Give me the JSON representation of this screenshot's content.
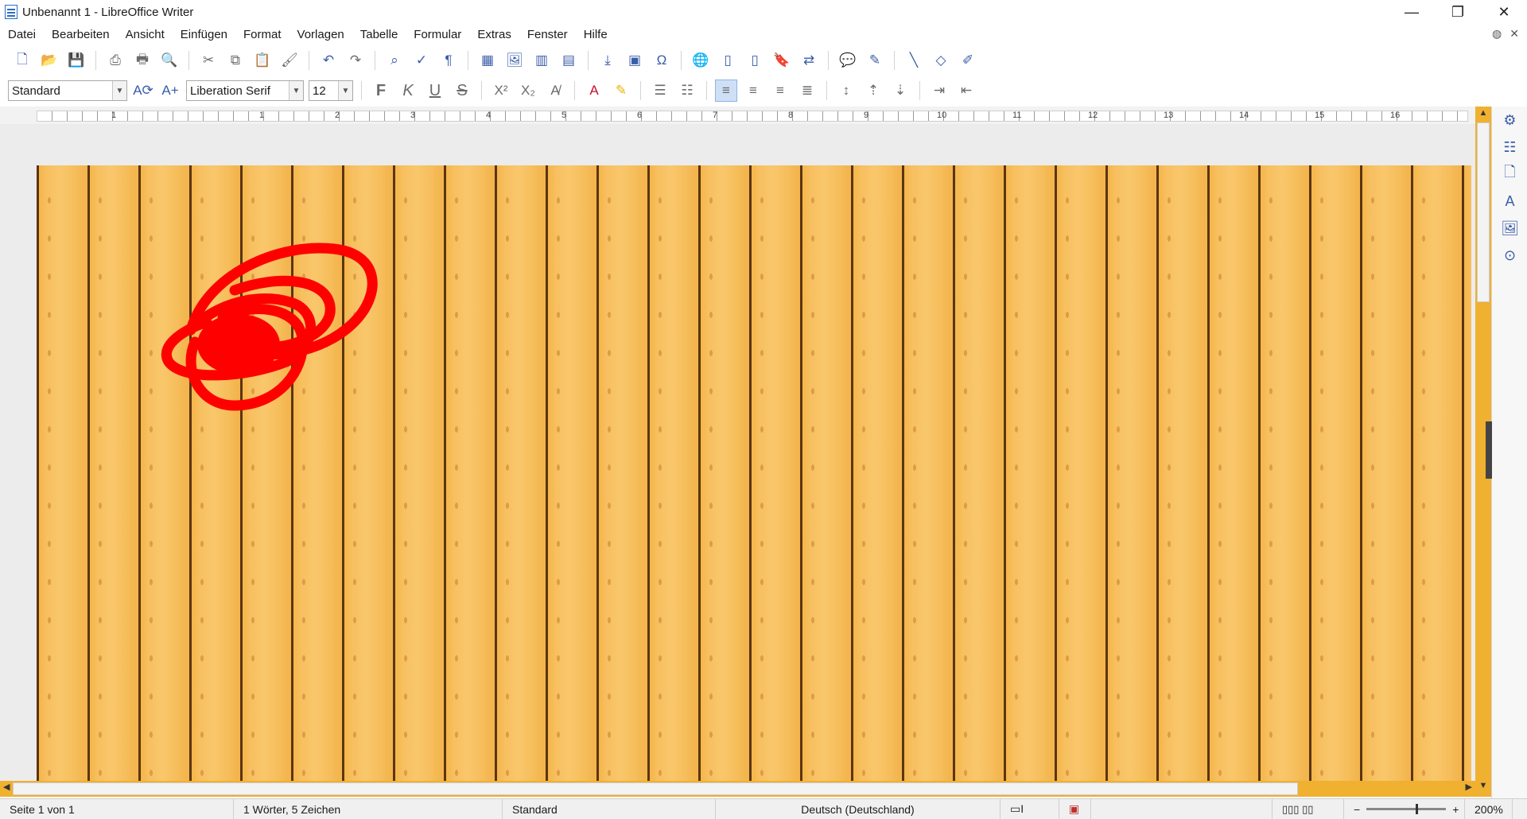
{
  "window": {
    "title": "Unbenannt 1 - LibreOffice Writer",
    "controls": {
      "minimize": "—",
      "maximize": "❐",
      "close": "✕"
    }
  },
  "menubar": {
    "items": [
      "Datei",
      "Bearbeiten",
      "Ansicht",
      "Einfügen",
      "Format",
      "Vorlagen",
      "Tabelle",
      "Formular",
      "Extras",
      "Fenster",
      "Hilfe"
    ]
  },
  "toolbar_format": {
    "paragraph_style": "Standard",
    "font_name": "Liberation Serif",
    "font_size": "12",
    "bold_label": "F",
    "italic_label": "K",
    "underline_label": "U",
    "strike_label": "S"
  },
  "ruler": {
    "labels": [
      "1",
      "1",
      "2",
      "3",
      "4",
      "5",
      "6",
      "7",
      "8",
      "9",
      "10",
      "11",
      "12",
      "13",
      "14",
      "15",
      "16"
    ]
  },
  "statusbar": {
    "page": "Seite 1 von 1",
    "words": "1 Wörter, 5 Zeichen",
    "page_style": "Standard",
    "language": "Deutsch (Deutschland)",
    "zoom": "200%"
  },
  "colors": {
    "wood_light": "#f7c061",
    "wood_dark": "#5a3510",
    "scribble": "#ff0000",
    "accent": "#3a5da8"
  }
}
